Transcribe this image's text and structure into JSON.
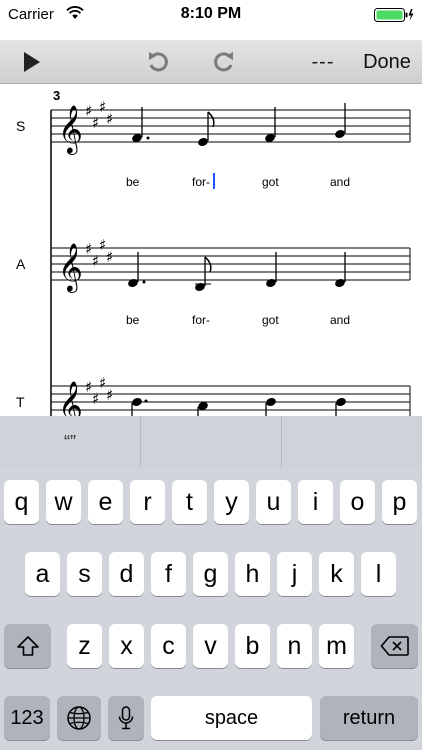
{
  "status": {
    "carrier": "Carrier",
    "time": "8:10 PM"
  },
  "toolbar": {
    "dashes": "---",
    "done": "Done"
  },
  "score": {
    "measure_number": "3",
    "parts": [
      {
        "label": "S",
        "lyrics": [
          "be",
          "for-",
          "got",
          "and"
        ]
      },
      {
        "label": "A",
        "lyrics": [
          "be",
          "for-",
          "got",
          "and"
        ]
      },
      {
        "label": "T"
      }
    ]
  },
  "suggestions": [
    "“”",
    "",
    ""
  ],
  "keyboard": {
    "row1": [
      "q",
      "w",
      "e",
      "r",
      "t",
      "y",
      "u",
      "i",
      "o",
      "p"
    ],
    "row2": [
      "a",
      "s",
      "d",
      "f",
      "g",
      "h",
      "j",
      "k",
      "l"
    ],
    "row3": [
      "z",
      "x",
      "c",
      "v",
      "b",
      "n",
      "m"
    ],
    "numbers_label": "123",
    "space_label": "space",
    "return_label": "return"
  },
  "colors": {
    "cursor": "#1a56ff",
    "battery": "#4cd964"
  }
}
